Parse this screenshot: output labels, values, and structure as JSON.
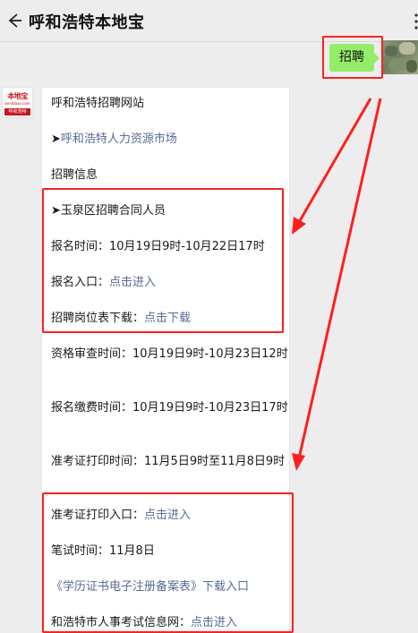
{
  "header": {
    "title": "呼和浩特本地宝"
  },
  "outgoing_message": {
    "text": "招聘"
  },
  "bot_avatar": {
    "logo_top": "本地宝",
    "logo_mid": "bendibao.com",
    "logo_bar": "呼和浩特"
  },
  "card": {
    "site_title": "呼和浩特招聘网站",
    "hr_market": {
      "arrow": "➤",
      "text": "呼和浩特人力资源市场"
    },
    "section_label": "招聘信息",
    "yuquan": {
      "arrow": "➤",
      "text": "玉泉区招聘合同人员"
    },
    "registration_time": {
      "label": "报名时间：",
      "value": "10月19日9时-10月22日17时"
    },
    "registration_entry": {
      "label": "报名入口：",
      "link": "点击进入"
    },
    "position_list": {
      "label": "招聘岗位表下载：",
      "link": "点击下载"
    },
    "review_time": {
      "label": "资格审查时间：",
      "value": "10月19日9时-10月23日12时"
    },
    "payment_time": {
      "label": "报名缴费时间：",
      "value": "10月19日9时-10月23日17时"
    },
    "admission_print_time": {
      "label": "准考证打印时间：",
      "value": "11月5日9时至11月8日9时"
    },
    "admission_print_entry": {
      "label": "准考证打印入口：",
      "link": "点击进入"
    },
    "exam_time": {
      "label": "笔试时间：",
      "value": "11月8日"
    },
    "diploma_form": {
      "link": "《学历证书电子注册备案表》",
      "suffix": "下载入口"
    },
    "exam_info_site": {
      "label": "和浩特市人事考试信息网：",
      "link": "点击进入"
    }
  },
  "colors": {
    "background": "#ededed",
    "bubble_green": "#95ec69",
    "link_blue": "#576b95",
    "annotation_red": "#ff1f1f",
    "logo_red": "#c8141e"
  }
}
